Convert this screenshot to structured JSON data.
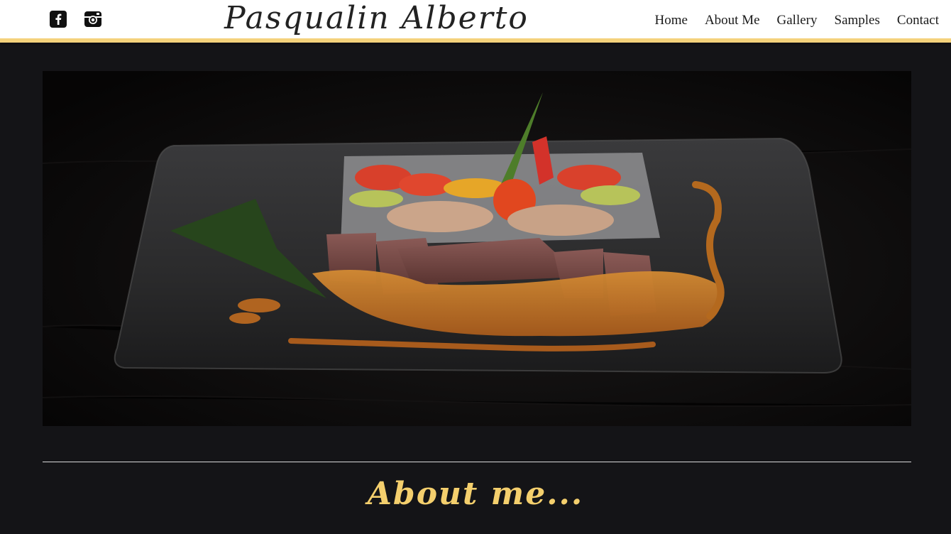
{
  "header": {
    "brand": "Pasqualin Alberto",
    "social": [
      "facebook-icon",
      "instagram-icon"
    ],
    "nav": [
      "Home",
      "About Me",
      "Gallery",
      "Samples",
      "Contact"
    ]
  },
  "hero": {
    "alt": "Plated sliced steak with sauce and grilled vegetables"
  },
  "section": {
    "heading": "About me..."
  },
  "colors": {
    "accent": "#f4d27c",
    "background": "#141417",
    "header": "#ffffff"
  }
}
